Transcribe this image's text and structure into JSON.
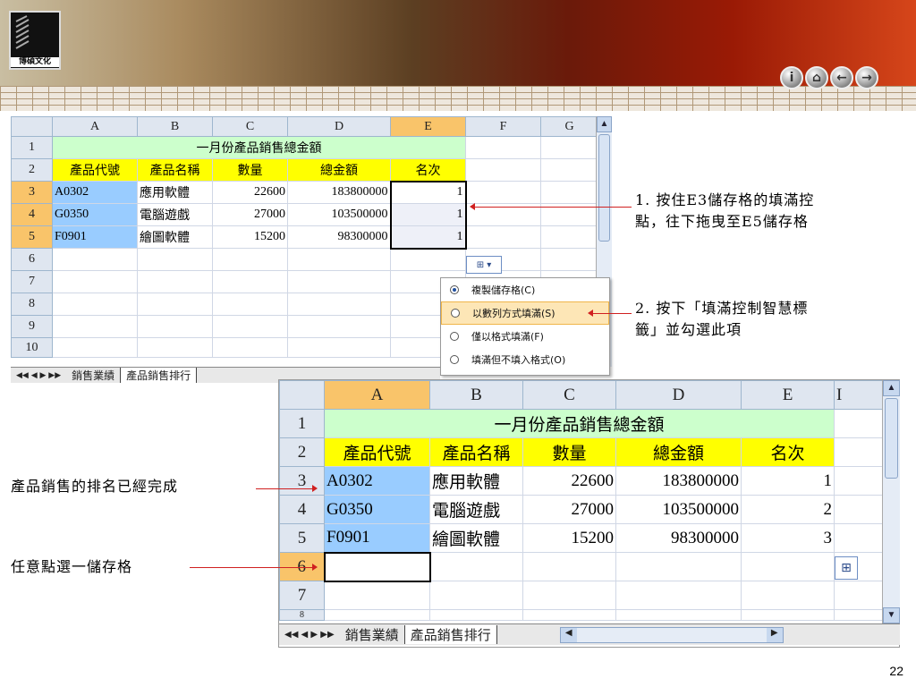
{
  "logo": {
    "text": "博碩文化"
  },
  "nav": [
    "i",
    "⌂",
    "←",
    "→"
  ],
  "sheet1": {
    "columns": [
      "A",
      "B",
      "C",
      "D",
      "E",
      "F",
      "G"
    ],
    "rows": [
      "1",
      "2",
      "3",
      "4",
      "5",
      "6",
      "7",
      "8",
      "9",
      "10"
    ],
    "title": "一月份產品銷售總金額",
    "headers": [
      "產品代號",
      "產品名稱",
      "數量",
      "總金額",
      "名次"
    ],
    "data": [
      [
        "A0302",
        "應用軟體",
        "22600",
        "183800000",
        "1"
      ],
      [
        "G0350",
        "電腦遊戲",
        "27000",
        "103500000",
        "1"
      ],
      [
        "F0901",
        "繪圖軟體",
        "15200",
        "98300000",
        "1"
      ]
    ],
    "tabs": [
      "銷售業績",
      "產品銷售排行"
    ]
  },
  "menu": [
    "複製儲存格(C)",
    "以數列方式填滿(S)",
    "僅以格式填滿(F)",
    "填滿但不填入格式(O)"
  ],
  "sheet2": {
    "columns": [
      "A",
      "B",
      "C",
      "D",
      "E",
      "I"
    ],
    "rows": [
      "1",
      "2",
      "3",
      "4",
      "5",
      "6",
      "7",
      "8"
    ],
    "title": "一月份產品銷售總金額",
    "headers": [
      "產品代號",
      "產品名稱",
      "數量",
      "總金額",
      "名次"
    ],
    "data": [
      [
        "A0302",
        "應用軟體",
        "22600",
        "183800000",
        "1"
      ],
      [
        "G0350",
        "電腦遊戲",
        "27000",
        "103500000",
        "2"
      ],
      [
        "F0901",
        "繪圖軟體",
        "15200",
        "98300000",
        "3"
      ]
    ],
    "tabs": [
      "銷售業績",
      "產品銷售排行"
    ]
  },
  "notes": {
    "n1a": "1. 按住E3儲存格的填滿控",
    "n1b": "點，往下拖曳至E5儲存格",
    "n2a": "2. 按下「填滿控制智慧標",
    "n2b": "籤」並勾選此項",
    "n3": "產品銷售的排名已經完成",
    "n4": "任意點選一儲存格"
  },
  "page": "22"
}
